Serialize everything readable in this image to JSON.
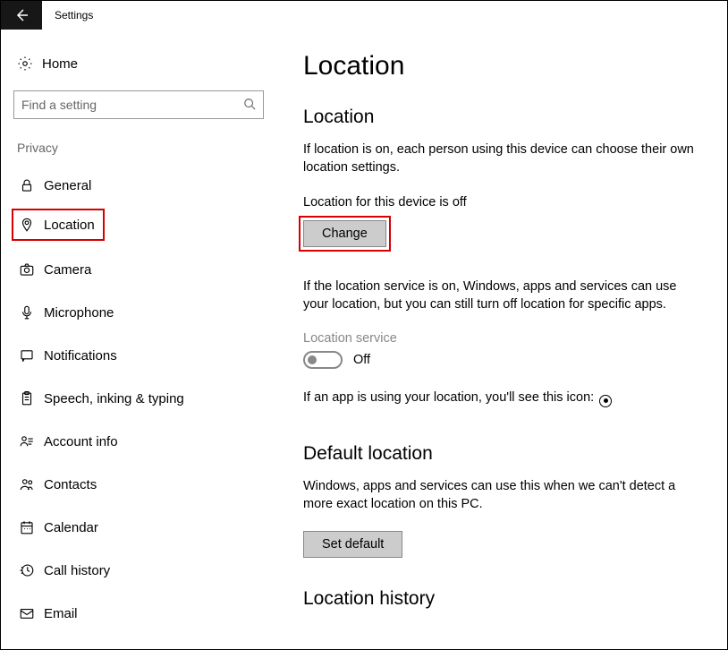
{
  "titlebar": {
    "label": "Settings"
  },
  "sidebar": {
    "home": "Home",
    "search_placeholder": "Find a setting",
    "group": "Privacy",
    "items": [
      {
        "label": "General"
      },
      {
        "label": "Location",
        "highlight": true
      },
      {
        "label": "Camera"
      },
      {
        "label": "Microphone"
      },
      {
        "label": "Notifications"
      },
      {
        "label": "Speech, inking & typing"
      },
      {
        "label": "Account info"
      },
      {
        "label": "Contacts"
      },
      {
        "label": "Calendar"
      },
      {
        "label": "Call history"
      },
      {
        "label": "Email"
      }
    ]
  },
  "main": {
    "title": "Location",
    "section1": {
      "heading": "Location",
      "desc": "If location is on, each person using this device can choose their own location settings.",
      "status": "Location for this device is off",
      "change_btn": "Change",
      "desc2": "If the location service is on, Windows, apps and services can use your location, but you can still turn off location for specific apps.",
      "service_label": "Location service",
      "toggle_state": "Off",
      "icon_note": "If an app is using your location, you'll see this icon:"
    },
    "section2": {
      "heading": "Default location",
      "desc": "Windows, apps and services can use this when we can't detect a more exact location on this PC.",
      "btn": "Set default"
    },
    "section3": {
      "heading": "Location history"
    }
  }
}
